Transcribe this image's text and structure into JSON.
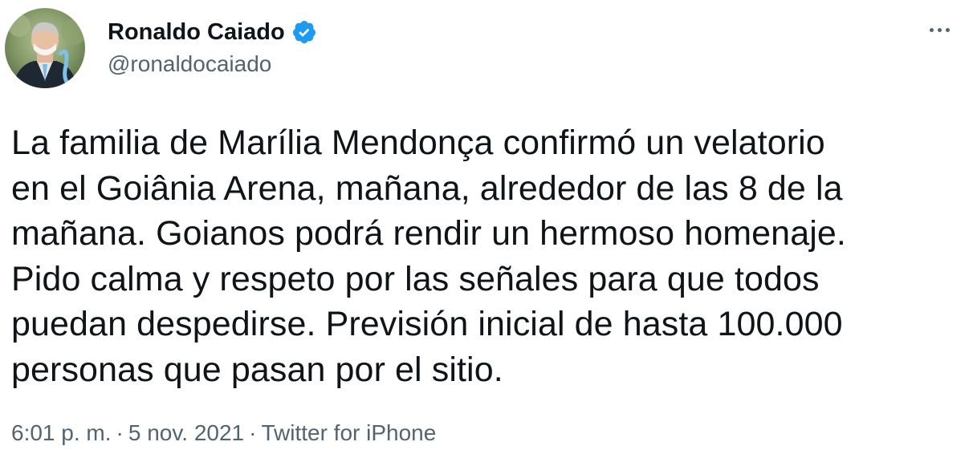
{
  "author": {
    "display_name": "Ronaldo Caiado",
    "handle": "@ronaldocaiado",
    "verified": true,
    "verified_color": "#1d9bf0"
  },
  "tweet": {
    "text": "La familia de Marília Mendonça confirmó un velatorio\nen el Goiânia Arena, mañana, alrededor de las 8 de la\nmañana. Goianos podrá rendir un hermoso homenaje.\nPido calma y respeto por las señales para que todos\npuedan despedirse. Previsión inicial de hasta 100.000\npersonas que pasan por el sitio."
  },
  "meta": {
    "time": "6:01 p. m.",
    "separator": "·",
    "date": "5 nov. 2021",
    "source": "Twitter for iPhone"
  },
  "icons": {
    "more": "more-options-icon",
    "verified": "verified-badge-icon"
  }
}
